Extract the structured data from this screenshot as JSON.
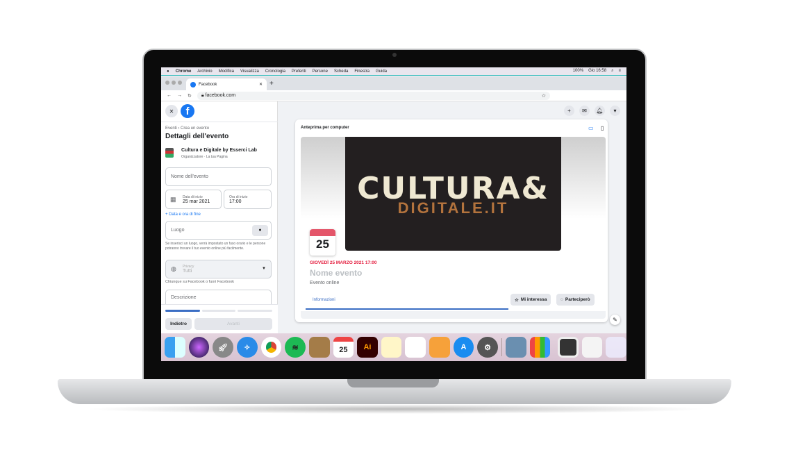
{
  "menubar": {
    "apple": "",
    "items": [
      "Chrome",
      "Archivio",
      "Modifica",
      "Visualizza",
      "Cronologia",
      "Preferiti",
      "Persone",
      "Scheda",
      "Finestra",
      "Guida"
    ],
    "status": [
      "100%",
      "Gio 16:58"
    ]
  },
  "browser": {
    "tab_title": "Facebook",
    "url": "facebook.com",
    "new_tab": "+",
    "close_tab": "✕"
  },
  "left": {
    "breadcrumb": "Eventi › Crea un evento",
    "title": "Dettagli dell'evento",
    "org_name": "Cultura e Digitale by Esserci Lab",
    "org_sub": "Organizzatore · La tua Pagina",
    "event_name_placeholder": "Nome dell'evento",
    "start_date_label": "Data di inizio",
    "start_date": "25 mar 2021",
    "start_time_label": "Ora di inizio",
    "start_time": "17:00",
    "end_link": "+ Data e ora di fine",
    "place_placeholder": "Luogo",
    "place_hint": "Se inserisci un luogo, verrà impostato un fuso orario e le persone potranno trovare il tuo evento online più facilmente.",
    "privacy_label": "Privacy",
    "privacy_value": "Tutti",
    "privacy_hint": "Chiunque su Facebook o fuori Facebook",
    "description_placeholder": "Descrizione",
    "back": "Indietro",
    "next": "Avanti",
    "progress_step": 1,
    "progress_steps": 3
  },
  "preview": {
    "title": "Anteprima per computer",
    "cover_text": "CULTURA&",
    "cover_text2": "DIGITALE.IT",
    "cal_day": "25",
    "date": "GIOVEDÌ 25 MARZO 2021 17:00",
    "event_name": "Nome evento",
    "event_type": "Evento online",
    "tab": "Informazioni",
    "interested": "Mi interessa",
    "going": "Parteciperò"
  },
  "colors": {
    "fb_blue": "#1877f2",
    "date_red": "#e41e3f",
    "dock": "#dcc8d6"
  },
  "dock": [
    "finder",
    "siri",
    "launchpad",
    "safari",
    "chrome",
    "spotify",
    "notefile",
    "calendar",
    "illustrator",
    "notes",
    "reminders",
    "pages",
    "app-store",
    "system-preferences",
    "preview",
    "numbers",
    "screenshot",
    "document",
    "trash"
  ],
  "dock_calendar": "25",
  "dock_ai": "Ai"
}
